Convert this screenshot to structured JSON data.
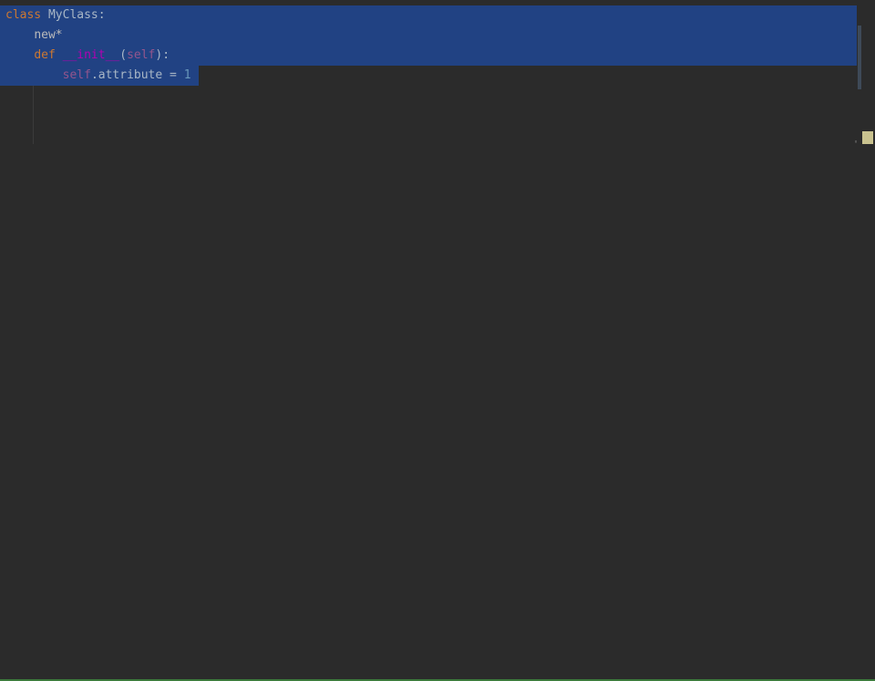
{
  "code": {
    "line1": {
      "kw": "class",
      "name": "MyClass",
      "colon": ":"
    },
    "line2": {
      "indent": "    ",
      "text": "new*"
    },
    "line3": {
      "indent": "    ",
      "kw": "def",
      "dunder": "__init__",
      "lparen": "(",
      "self": "self",
      "rparen_colon": "):"
    },
    "line4": {
      "indent": "        ",
      "self": "self",
      "dot_attr": ".attribute",
      "eq": " = ",
      "value": "1"
    }
  },
  "scrollbar": {
    "caret_tick": "'"
  }
}
